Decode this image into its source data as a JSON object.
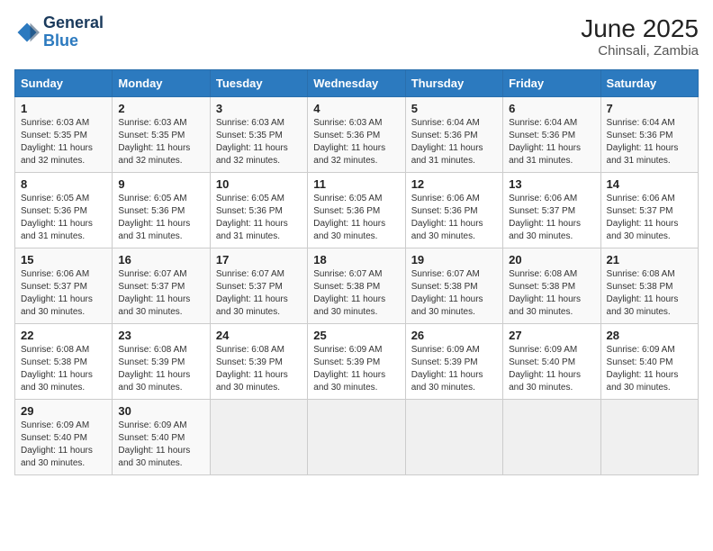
{
  "header": {
    "logo_line1": "General",
    "logo_line2": "Blue",
    "title": "June 2025",
    "subtitle": "Chinsali, Zambia"
  },
  "calendar": {
    "days_of_week": [
      "Sunday",
      "Monday",
      "Tuesday",
      "Wednesday",
      "Thursday",
      "Friday",
      "Saturday"
    ],
    "weeks": [
      [
        {
          "day": "1",
          "sunrise": "6:03 AM",
          "sunset": "5:35 PM",
          "daylight": "11 hours and 32 minutes."
        },
        {
          "day": "2",
          "sunrise": "6:03 AM",
          "sunset": "5:35 PM",
          "daylight": "11 hours and 32 minutes."
        },
        {
          "day": "3",
          "sunrise": "6:03 AM",
          "sunset": "5:35 PM",
          "daylight": "11 hours and 32 minutes."
        },
        {
          "day": "4",
          "sunrise": "6:03 AM",
          "sunset": "5:36 PM",
          "daylight": "11 hours and 32 minutes."
        },
        {
          "day": "5",
          "sunrise": "6:04 AM",
          "sunset": "5:36 PM",
          "daylight": "11 hours and 31 minutes."
        },
        {
          "day": "6",
          "sunrise": "6:04 AM",
          "sunset": "5:36 PM",
          "daylight": "11 hours and 31 minutes."
        },
        {
          "day": "7",
          "sunrise": "6:04 AM",
          "sunset": "5:36 PM",
          "daylight": "11 hours and 31 minutes."
        }
      ],
      [
        {
          "day": "8",
          "sunrise": "6:05 AM",
          "sunset": "5:36 PM",
          "daylight": "11 hours and 31 minutes."
        },
        {
          "day": "9",
          "sunrise": "6:05 AM",
          "sunset": "5:36 PM",
          "daylight": "11 hours and 31 minutes."
        },
        {
          "day": "10",
          "sunrise": "6:05 AM",
          "sunset": "5:36 PM",
          "daylight": "11 hours and 31 minutes."
        },
        {
          "day": "11",
          "sunrise": "6:05 AM",
          "sunset": "5:36 PM",
          "daylight": "11 hours and 30 minutes."
        },
        {
          "day": "12",
          "sunrise": "6:06 AM",
          "sunset": "5:36 PM",
          "daylight": "11 hours and 30 minutes."
        },
        {
          "day": "13",
          "sunrise": "6:06 AM",
          "sunset": "5:37 PM",
          "daylight": "11 hours and 30 minutes."
        },
        {
          "day": "14",
          "sunrise": "6:06 AM",
          "sunset": "5:37 PM",
          "daylight": "11 hours and 30 minutes."
        }
      ],
      [
        {
          "day": "15",
          "sunrise": "6:06 AM",
          "sunset": "5:37 PM",
          "daylight": "11 hours and 30 minutes."
        },
        {
          "day": "16",
          "sunrise": "6:07 AM",
          "sunset": "5:37 PM",
          "daylight": "11 hours and 30 minutes."
        },
        {
          "day": "17",
          "sunrise": "6:07 AM",
          "sunset": "5:37 PM",
          "daylight": "11 hours and 30 minutes."
        },
        {
          "day": "18",
          "sunrise": "6:07 AM",
          "sunset": "5:38 PM",
          "daylight": "11 hours and 30 minutes."
        },
        {
          "day": "19",
          "sunrise": "6:07 AM",
          "sunset": "5:38 PM",
          "daylight": "11 hours and 30 minutes."
        },
        {
          "day": "20",
          "sunrise": "6:08 AM",
          "sunset": "5:38 PM",
          "daylight": "11 hours and 30 minutes."
        },
        {
          "day": "21",
          "sunrise": "6:08 AM",
          "sunset": "5:38 PM",
          "daylight": "11 hours and 30 minutes."
        }
      ],
      [
        {
          "day": "22",
          "sunrise": "6:08 AM",
          "sunset": "5:38 PM",
          "daylight": "11 hours and 30 minutes."
        },
        {
          "day": "23",
          "sunrise": "6:08 AM",
          "sunset": "5:39 PM",
          "daylight": "11 hours and 30 minutes."
        },
        {
          "day": "24",
          "sunrise": "6:08 AM",
          "sunset": "5:39 PM",
          "daylight": "11 hours and 30 minutes."
        },
        {
          "day": "25",
          "sunrise": "6:09 AM",
          "sunset": "5:39 PM",
          "daylight": "11 hours and 30 minutes."
        },
        {
          "day": "26",
          "sunrise": "6:09 AM",
          "sunset": "5:39 PM",
          "daylight": "11 hours and 30 minutes."
        },
        {
          "day": "27",
          "sunrise": "6:09 AM",
          "sunset": "5:40 PM",
          "daylight": "11 hours and 30 minutes."
        },
        {
          "day": "28",
          "sunrise": "6:09 AM",
          "sunset": "5:40 PM",
          "daylight": "11 hours and 30 minutes."
        }
      ],
      [
        {
          "day": "29",
          "sunrise": "6:09 AM",
          "sunset": "5:40 PM",
          "daylight": "11 hours and 30 minutes."
        },
        {
          "day": "30",
          "sunrise": "6:09 AM",
          "sunset": "5:40 PM",
          "daylight": "11 hours and 30 minutes."
        },
        null,
        null,
        null,
        null,
        null
      ]
    ]
  }
}
